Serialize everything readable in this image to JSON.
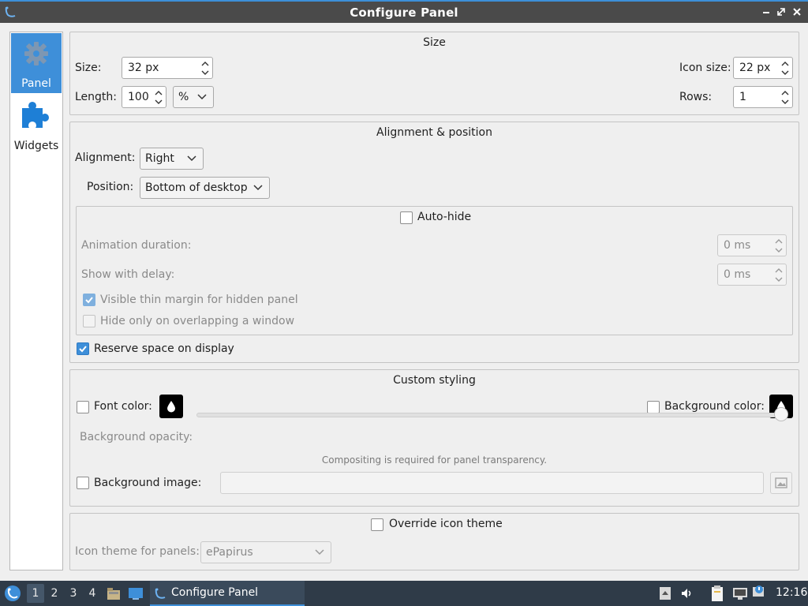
{
  "window": {
    "title": "Configure Panel"
  },
  "sidebar": {
    "items": [
      {
        "label": "Panel"
      },
      {
        "label": "Widgets"
      }
    ]
  },
  "size_group": {
    "title": "Size",
    "size_label": "Size:",
    "size_value": "32 px",
    "length_label": "Length:",
    "length_value": "100",
    "length_unit": "%",
    "icon_size_label": "Icon size:",
    "icon_size_value": "22 px",
    "rows_label": "Rows:",
    "rows_value": "1"
  },
  "alignment_group": {
    "title": "Alignment & position",
    "alignment_label": "Alignment:",
    "alignment_value": "Right",
    "position_label": "Position:",
    "position_value": "Bottom of desktop",
    "autohide_label": "Auto-hide",
    "autohide_checked": false,
    "animation_label": "Animation duration:",
    "animation_value": "0 ms",
    "delay_label": "Show with delay:",
    "delay_value": "0 ms",
    "thin_margin_label": "Visible thin margin for hidden panel",
    "thin_margin_checked": true,
    "overlap_label": "Hide only on overlapping a window",
    "overlap_checked": false,
    "reserve_label": "Reserve space on display",
    "reserve_checked": true
  },
  "styling_group": {
    "title": "Custom styling",
    "font_color_label": "Font color:",
    "font_color_checked": false,
    "bg_color_label": "Background color:",
    "bg_color_checked": false,
    "opacity_label": "Background opacity:",
    "opacity_value_percent": 100,
    "compositing_note": "Compositing is required for panel transparency.",
    "bg_image_label": "Background image:",
    "bg_image_checked": false,
    "bg_image_value": ""
  },
  "icon_group": {
    "override_label": "Override icon theme",
    "override_checked": false,
    "theme_label": "Icon theme for panels:",
    "theme_value": "ePapirus"
  },
  "taskbar": {
    "desktops": [
      "1",
      "2",
      "3",
      "4"
    ],
    "active_desktop": "1",
    "task_title": "Configure Panel",
    "clock": "12:16"
  },
  "colors": {
    "accent": "#3e8fd9",
    "titlebar": "#4a4a4a",
    "taskbar": "#2f3b48"
  }
}
